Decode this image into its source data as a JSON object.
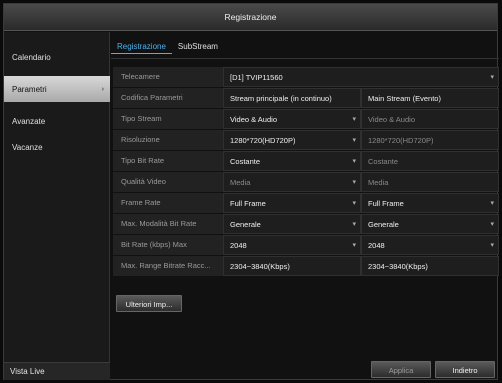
{
  "window": {
    "title": "Registrazione"
  },
  "sidebar": {
    "items": [
      {
        "label": "Calendario"
      },
      {
        "label": "Parametri"
      },
      {
        "label": "Avanzate"
      },
      {
        "label": "Vacanze"
      }
    ],
    "live_label": "Vista Live"
  },
  "tabs": [
    {
      "label": "Registrazione"
    },
    {
      "label": "SubStream"
    }
  ],
  "form": {
    "camera": {
      "label": "Telecamere",
      "value": "[D1] TVIP11560"
    },
    "codifica": {
      "label": "Codifica Parametri",
      "a": "Stream principale (in continuo)",
      "b": "Main Stream (Evento)"
    },
    "tipo_stream": {
      "label": "Tipo Stream",
      "a": "Video & Audio",
      "b": "Video & Audio"
    },
    "risoluzione": {
      "label": "Risoluzione",
      "a": "1280*720(HD720P)",
      "b": "1280*720(HD720P)"
    },
    "tipo_bitrate": {
      "label": "Tipo Bit Rate",
      "a": "Costante",
      "b": "Costante"
    },
    "qualita": {
      "label": "Qualità Video",
      "a": "Media",
      "b": "Media"
    },
    "frame_rate": {
      "label": "Frame Rate",
      "a": "Full Frame",
      "b": "Full Frame"
    },
    "max_modalita": {
      "label": "Max. Modalità Bit Rate",
      "a": "Generale",
      "b": "Generale"
    },
    "bitrate_max": {
      "label": "Bit Rate (kbps) Max",
      "a": "2048",
      "b": "2048"
    },
    "range": {
      "label": "Max. Range Bitrate Racc...",
      "a": "2304~3840(Kbps)",
      "b": "2304~3840(Kbps)"
    }
  },
  "buttons": {
    "more": "Ulteriori Imp...",
    "apply": "Applica",
    "back": "Indietro"
  },
  "icons": {
    "dropdown": "▾",
    "chevron": "›"
  }
}
